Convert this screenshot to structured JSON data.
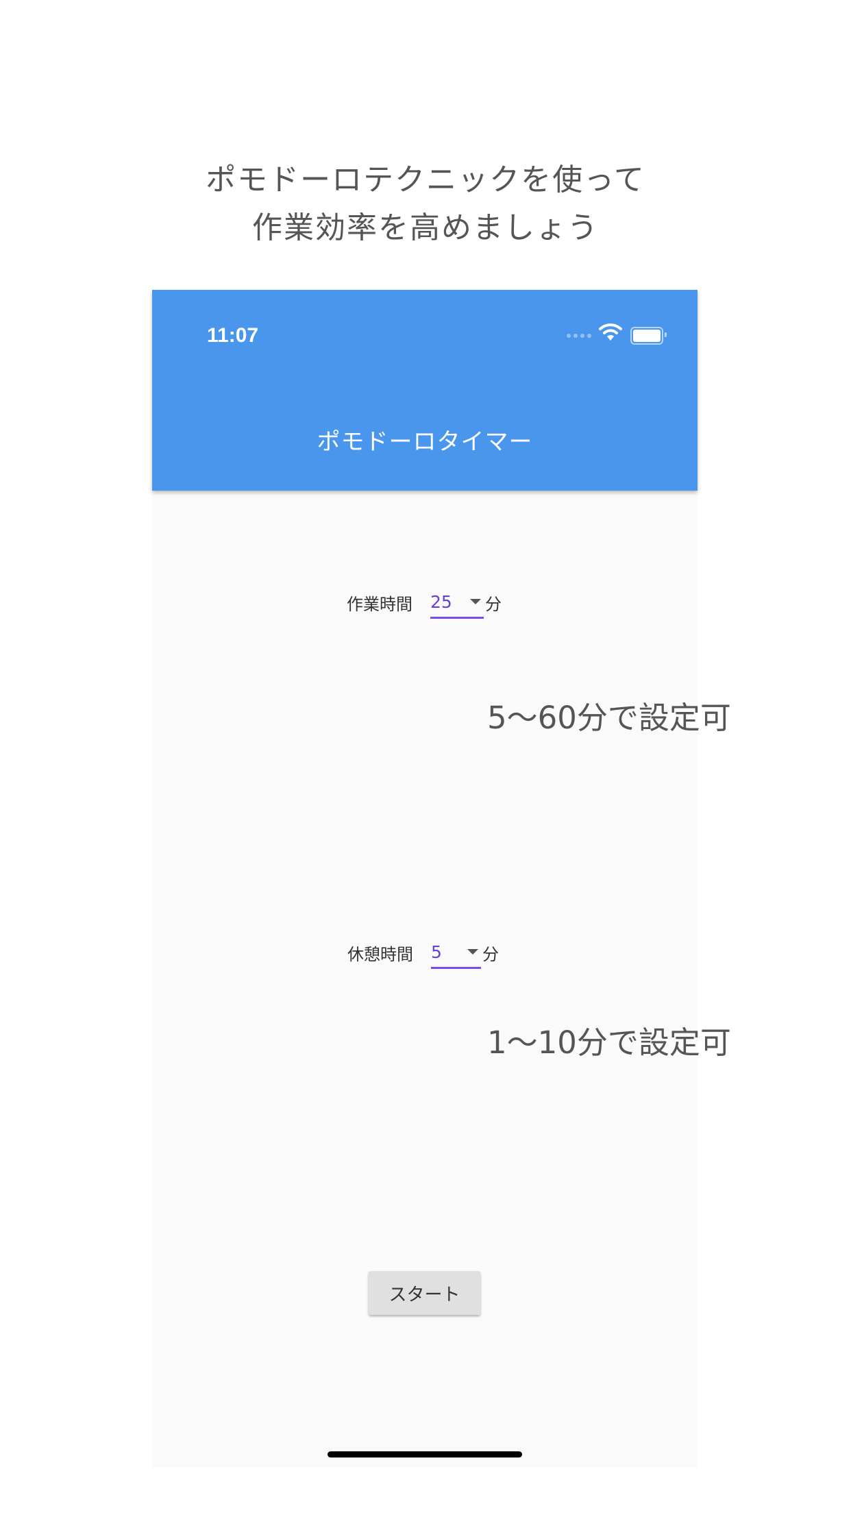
{
  "promo": {
    "line1": "ポモドーロテクニックを使って",
    "line2": "作業効率を高めましょう"
  },
  "status_bar": {
    "time": "11:07",
    "icons": [
      "cellular-signal-icon",
      "wifi-icon",
      "battery-icon"
    ]
  },
  "app_bar": {
    "title": "ポモドーロタイマー",
    "color": "#4a96ec"
  },
  "work": {
    "label": "作業時間",
    "value": "25",
    "unit": "分",
    "hint": "5〜60分で設定可"
  },
  "break": {
    "label": "休憩時間",
    "value": "5",
    "unit": "分",
    "hint": "1〜10分で設定可"
  },
  "start_button": {
    "label": "スタート"
  },
  "colors": {
    "accent": "#7a4bee",
    "value_text": "#6a3fd0",
    "background": "#fafafa"
  }
}
